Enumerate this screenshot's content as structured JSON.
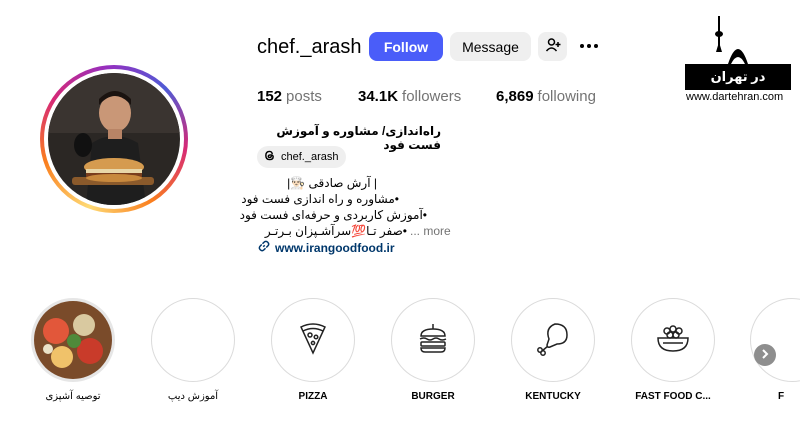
{
  "profile": {
    "username": "chef._arash",
    "follow_label": "Follow",
    "message_label": "Message",
    "stats": {
      "posts_count": "152",
      "posts_label": "posts",
      "followers_count": "34.1K",
      "followers_label": "followers",
      "following_count": "6,869",
      "following_label": "following"
    },
    "bio_title": "راه‌اندازی/ مشاوره و آموزش فست فود",
    "threads_handle": "chef._arash",
    "bio_lines": [
      "| آرش صادقی 👨🏻‍🍳|",
      "•مشاوره و راه اندازی فست فود",
      "•آموزش کاربردی و حرفه‌ای فست فود",
      "•صفر تـا💯سرآشـپزان بـرتـر"
    ],
    "more_label": "... more",
    "website": "www.irangoodfood.ir"
  },
  "watermark": {
    "brand": "در تهران",
    "url": "www.dartehran.com"
  },
  "highlights": [
    {
      "label": "توصیه آشپزی",
      "icon": "food-photo"
    },
    {
      "label": "آموزش دیپ",
      "icon": "empty"
    },
    {
      "label": "PIZZA",
      "icon": "pizza-icon"
    },
    {
      "label": "BURGER",
      "icon": "burger-icon"
    },
    {
      "label": "KENTUCKY",
      "icon": "chicken-leg-icon"
    },
    {
      "label": "FAST FOOD C...",
      "icon": "food-bowl-icon"
    },
    {
      "label": "F",
      "icon": "partial"
    }
  ],
  "colors": {
    "follow_button": "#4a5df9",
    "secondary_button": "#efefef",
    "link": "#00376b",
    "muted_text": "#737373"
  }
}
